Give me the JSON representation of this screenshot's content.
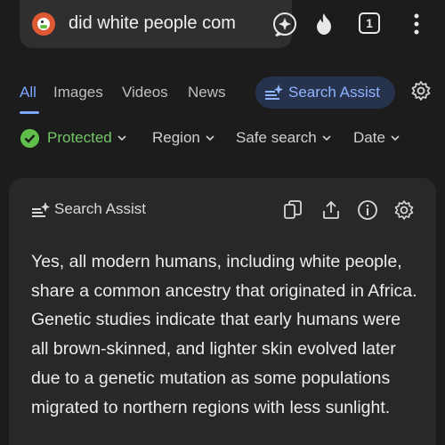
{
  "search": {
    "query": "did white people com"
  },
  "toolbar": {
    "tab_count": "1"
  },
  "nav": {
    "tabs": [
      {
        "label": "All"
      },
      {
        "label": "Images"
      },
      {
        "label": "Videos"
      },
      {
        "label": "News"
      }
    ],
    "assist_label": "Search Assist"
  },
  "filters": {
    "protected": "Protected",
    "region": "Region",
    "safe_search": "Safe search",
    "date": "Date"
  },
  "card": {
    "title": "Search Assist",
    "answer": "Yes, all modern humans, including white people, share a common ancestry that originated in Africa. Genetic studies indicate that early humans were all brown-skinned, and lighter skin evolved later due to a genetic mutation as some populations migrated to northern regions with less sunlight."
  },
  "colors": {
    "background": "#1c1c1c",
    "accent": "#7aa8ff",
    "protected_green": "#5fbf4a",
    "card": "#282828"
  },
  "icons": [
    "duckduckgo-logo-icon",
    "search-assist-bubble-icon",
    "fire-icon",
    "tabs-icon",
    "more-vert-icon",
    "sparkle-list-icon",
    "gear-icon",
    "check-circle-icon",
    "chevron-down-icon",
    "copy-icon",
    "share-icon",
    "info-icon"
  ]
}
